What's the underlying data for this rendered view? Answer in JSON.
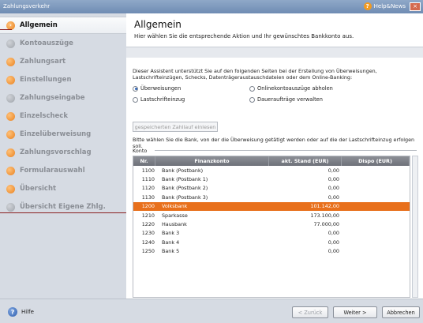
{
  "window": {
    "title": "Zahlungsverkehr",
    "help_news": "Help&News",
    "close": "×"
  },
  "sidebar": {
    "items": [
      {
        "label": "Allgemein",
        "active": true
      },
      {
        "label": "Kontoauszüge"
      },
      {
        "label": "Zahlungsart"
      },
      {
        "label": "Einstellungen"
      },
      {
        "label": "Zahlungseingabe"
      },
      {
        "label": "Einzelscheck"
      },
      {
        "label": "Einzelüberweisung"
      },
      {
        "label": "Zahlungsvorschlag"
      },
      {
        "label": "Formularauswahl"
      },
      {
        "label": "Übersicht"
      },
      {
        "label": "Übersicht Eigene Zhlg."
      }
    ]
  },
  "header": {
    "title": "Allgemein",
    "subtitle": "Hier wählen Sie die entsprechende Aktion und Ihr gewünschtes Bankkonto aus."
  },
  "main": {
    "intro": "Dieser Assistent unterstützt Sie auf den folgenden Seiten bei der Erstellung von Überweisungen, Lastschrifteinzügen, Schecks, Datenträgeraustauschdateien oder dem Online-Banking:",
    "options": [
      {
        "label": "Überweisungen",
        "checked": true
      },
      {
        "label": "Onlinekontoauszüge abholen",
        "checked": false
      },
      {
        "label": "Lastschrifteinzug",
        "checked": false
      },
      {
        "label": "Daueraufträge verwalten",
        "checked": false
      }
    ],
    "load_button": "gespeicherten Zahllauf einlesen",
    "choose_text": "Bitte wählen Sie die Bank, von der die Überweisung getätigt werden oder auf die der Lastschrifteinzug erfolgen soll.",
    "konto_label": "Konto"
  },
  "table": {
    "headers": [
      "Nr.",
      "Finanzkonto",
      "akt. Stand (EUR)",
      "Dispo (EUR)"
    ],
    "rows": [
      {
        "nr": "1100",
        "konto": "Bank (Postbank)",
        "stand": "0,00",
        "dispo": ""
      },
      {
        "nr": "1110",
        "konto": "Bank (Postbank 1)",
        "stand": "0,00",
        "dispo": ""
      },
      {
        "nr": "1120",
        "konto": "Bank (Postbank 2)",
        "stand": "0,00",
        "dispo": ""
      },
      {
        "nr": "1130",
        "konto": "Bank (Postbank 3)",
        "stand": "0,00",
        "dispo": ""
      },
      {
        "nr": "1200",
        "konto": "Volksbank",
        "stand": "101.142,00",
        "dispo": "",
        "selected": true
      },
      {
        "nr": "1210",
        "konto": "Sparkasse",
        "stand": "173.100,00",
        "dispo": ""
      },
      {
        "nr": "1220",
        "konto": "Hausbank",
        "stand": "77.000,00",
        "dispo": ""
      },
      {
        "nr": "1230",
        "konto": "Bank 3",
        "stand": "0,00",
        "dispo": ""
      },
      {
        "nr": "1240",
        "konto": "Bank 4",
        "stand": "0,00",
        "dispo": ""
      },
      {
        "nr": "1250",
        "konto": "Bank 5",
        "stand": "0,00",
        "dispo": ""
      }
    ]
  },
  "footer": {
    "help": "Hilfe",
    "back": "< Zurück",
    "next": "Weiter >",
    "cancel": "Abbrechen"
  },
  "colors": {
    "accent": "#e8701c",
    "marker": "#8a1f1f"
  }
}
